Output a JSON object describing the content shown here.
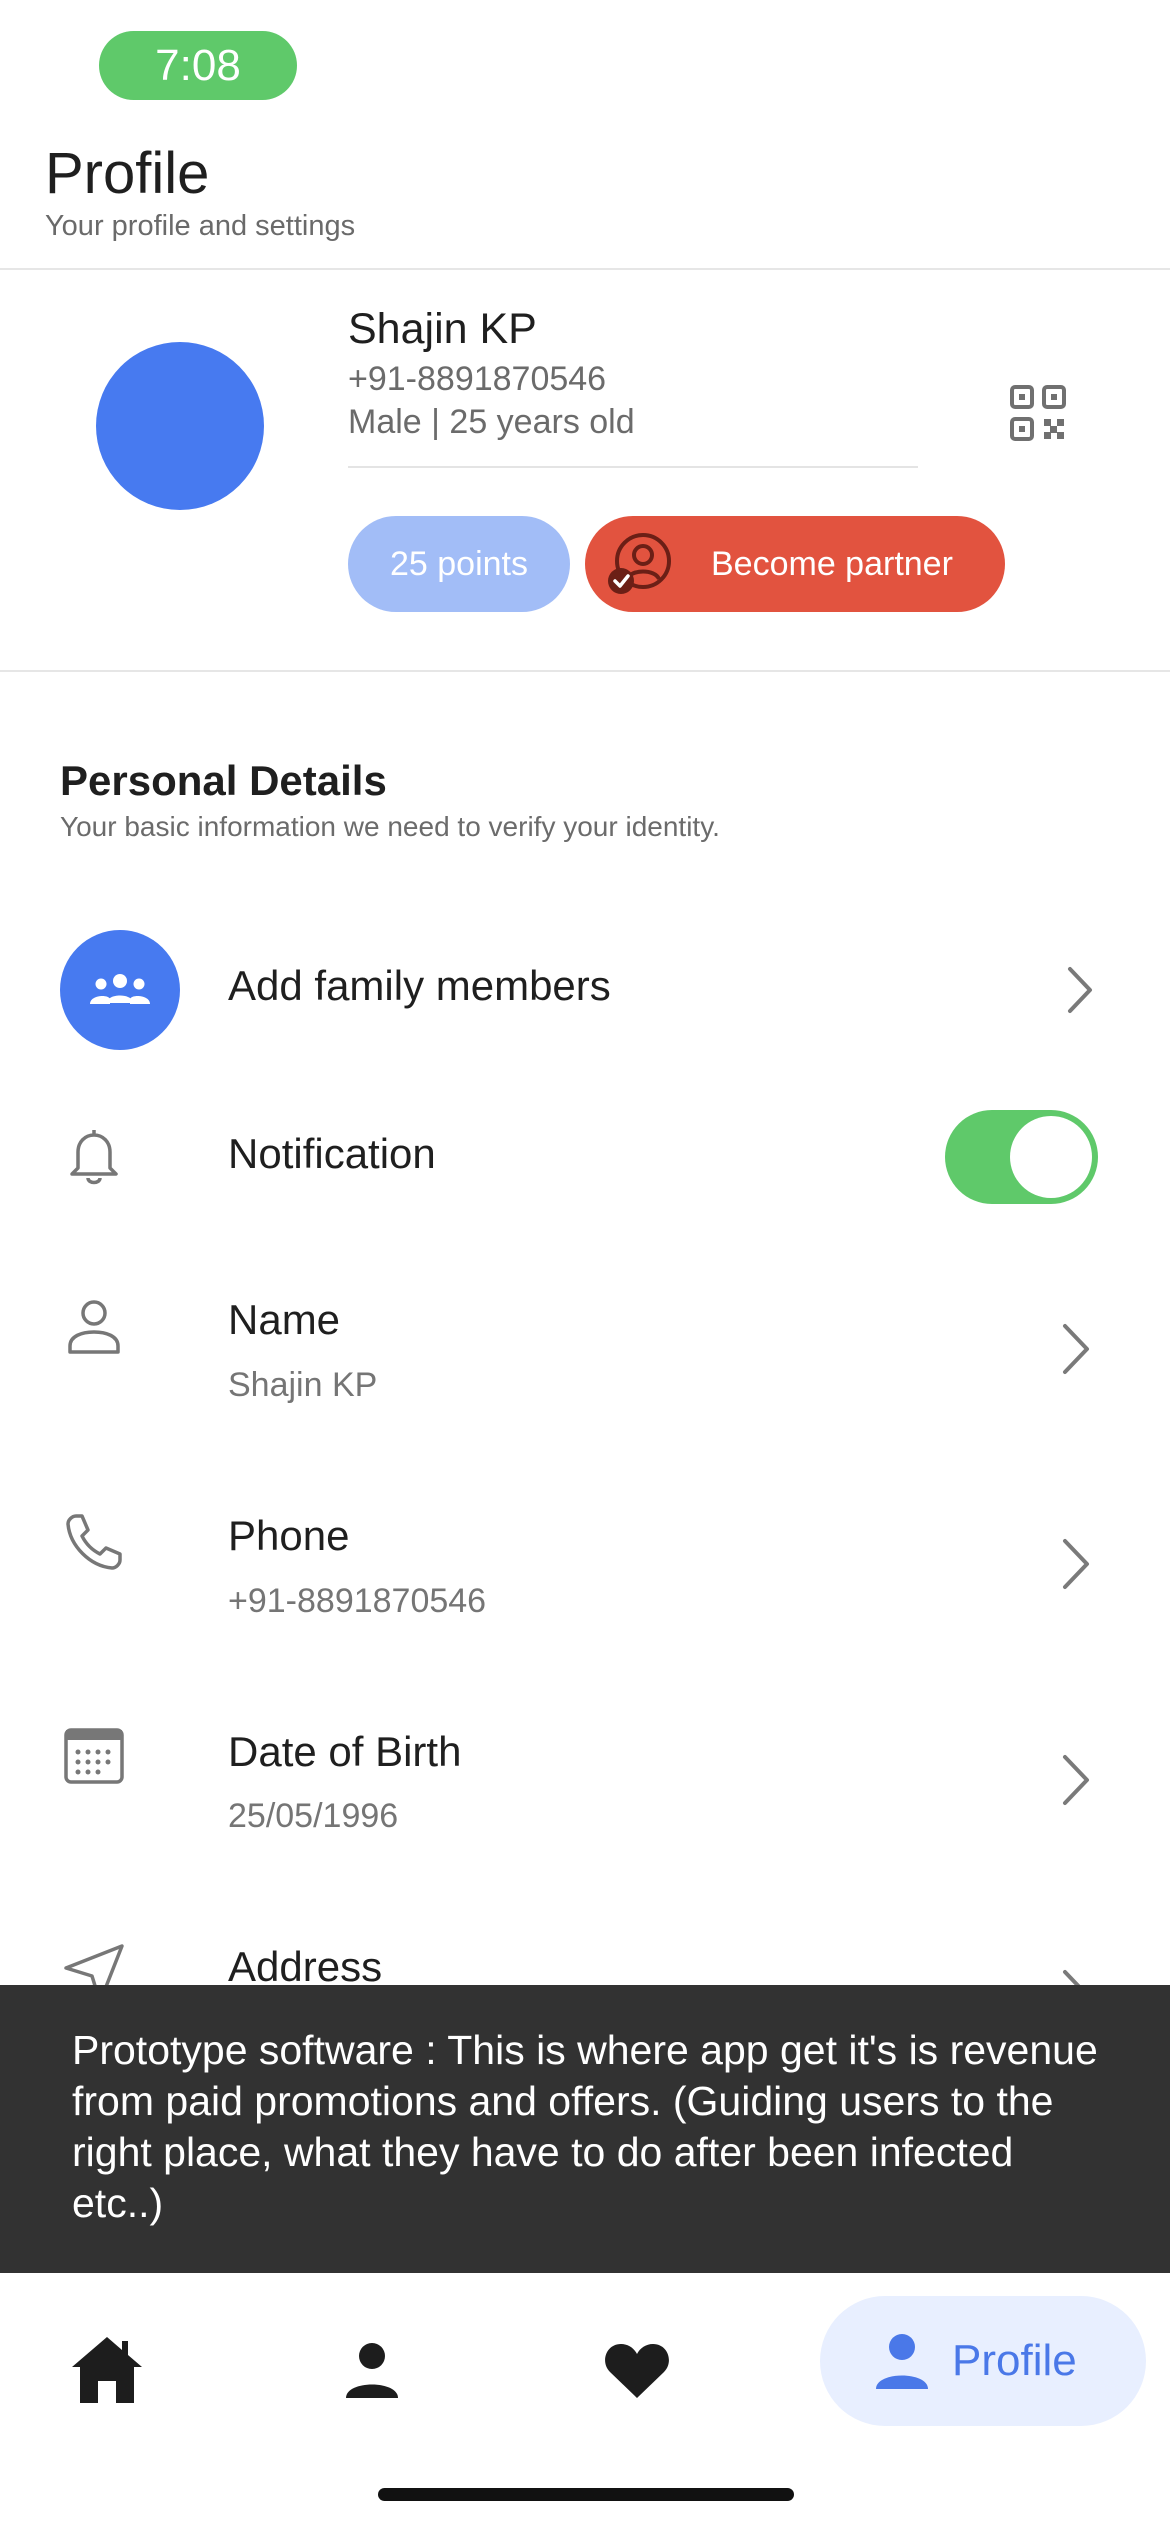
{
  "status_bar": {
    "time": "7:08"
  },
  "header": {
    "title": "Profile",
    "subtitle": "Your profile and settings"
  },
  "profile": {
    "name": "Shajin KP",
    "phone": "+91-8891870546",
    "meta": "Male | 25 years old",
    "points_label": "25 points",
    "partner_label": "Become partner"
  },
  "section": {
    "title": "Personal Details",
    "subtitle": "Your basic information we need to verify your identity."
  },
  "rows": {
    "family": {
      "label": "Add family members"
    },
    "notification": {
      "label": "Notification",
      "enabled": true
    },
    "name": {
      "label": "Name",
      "value": "Shajin KP"
    },
    "phone": {
      "label": "Phone",
      "value": "+91-8891870546"
    },
    "dob": {
      "label": "Date of Birth",
      "value": "25/05/1996"
    },
    "address": {
      "label": "Address"
    }
  },
  "banner": {
    "text": "Prototype software : This is where app get it's is revenue from paid promotions and offers. (Guiding users to the right place, what they have to do after been infected etc..)"
  },
  "bottom_nav": {
    "items": [
      "home-icon",
      "person-icon",
      "heart-icon",
      "profile-icon"
    ],
    "active_label": "Profile"
  },
  "colors": {
    "accent_blue": "#477af0",
    "toggle_green": "#5fc96a",
    "partner_red": "#e2533f",
    "points_blue": "#a2bdf7",
    "banner_bg": "#323232"
  }
}
